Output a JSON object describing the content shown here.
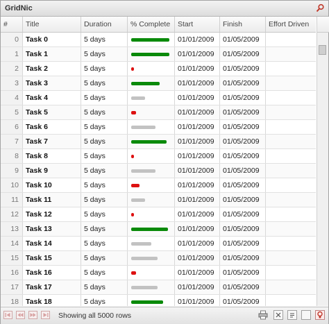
{
  "grid": {
    "title": "GridNic"
  },
  "columns": [
    {
      "key": "idx",
      "label": "#"
    },
    {
      "key": "title",
      "label": "Title"
    },
    {
      "key": "duration",
      "label": "Duration"
    },
    {
      "key": "pct",
      "label": "% Complete"
    },
    {
      "key": "start",
      "label": "Start"
    },
    {
      "key": "finish",
      "label": "Finish"
    },
    {
      "key": "effort",
      "label": "Effort Driven"
    }
  ],
  "rows": [
    {
      "idx": "0",
      "title": "Task 0",
      "duration": "5 days",
      "pct": 95,
      "start": "01/01/2009",
      "finish": "01/05/2009",
      "effort": ""
    },
    {
      "idx": "1",
      "title": "Task 1",
      "duration": "5 days",
      "pct": 95,
      "start": "01/01/2009",
      "finish": "01/05/2009",
      "effort": ""
    },
    {
      "idx": "2",
      "title": "Task 2",
      "duration": "5 days",
      "pct": 5,
      "start": "01/01/2009",
      "finish": "01/05/2009",
      "effort": ""
    },
    {
      "idx": "3",
      "title": "Task 3",
      "duration": "5 days",
      "pct": 70,
      "start": "01/01/2009",
      "finish": "01/05/2009",
      "effort": ""
    },
    {
      "idx": "4",
      "title": "Task 4",
      "duration": "5 days",
      "pct": 35,
      "start": "01/01/2009",
      "finish": "01/05/2009",
      "effort": ""
    },
    {
      "idx": "5",
      "title": "Task 5",
      "duration": "5 days",
      "pct": 12,
      "start": "01/01/2009",
      "finish": "01/05/2009",
      "effort": ""
    },
    {
      "idx": "6",
      "title": "Task 6",
      "duration": "5 days",
      "pct": 60,
      "start": "01/01/2009",
      "finish": "01/05/2009",
      "effort": ""
    },
    {
      "idx": "7",
      "title": "Task 7",
      "duration": "5 days",
      "pct": 88,
      "start": "01/01/2009",
      "finish": "01/05/2009",
      "effort": ""
    },
    {
      "idx": "8",
      "title": "Task 8",
      "duration": "5 days",
      "pct": 5,
      "start": "01/01/2009",
      "finish": "01/05/2009",
      "effort": ""
    },
    {
      "idx": "9",
      "title": "Task 9",
      "duration": "5 days",
      "pct": 60,
      "start": "01/01/2009",
      "finish": "01/05/2009",
      "effort": ""
    },
    {
      "idx": "10",
      "title": "Task 10",
      "duration": "5 days",
      "pct": 20,
      "start": "01/01/2009",
      "finish": "01/05/2009",
      "effort": ""
    },
    {
      "idx": "11",
      "title": "Task 11",
      "duration": "5 days",
      "pct": 35,
      "start": "01/01/2009",
      "finish": "01/05/2009",
      "effort": ""
    },
    {
      "idx": "12",
      "title": "Task 12",
      "duration": "5 days",
      "pct": 5,
      "start": "01/01/2009",
      "finish": "01/05/2009",
      "effort": ""
    },
    {
      "idx": "13",
      "title": "Task 13",
      "duration": "5 days",
      "pct": 92,
      "start": "01/01/2009",
      "finish": "01/05/2009",
      "effort": ""
    },
    {
      "idx": "14",
      "title": "Task 14",
      "duration": "5 days",
      "pct": 50,
      "start": "01/01/2009",
      "finish": "01/05/2009",
      "effort": ""
    },
    {
      "idx": "15",
      "title": "Task 15",
      "duration": "5 days",
      "pct": 65,
      "start": "01/01/2009",
      "finish": "01/05/2009",
      "effort": ""
    },
    {
      "idx": "16",
      "title": "Task 16",
      "duration": "5 days",
      "pct": 12,
      "start": "01/01/2009",
      "finish": "01/05/2009",
      "effort": ""
    },
    {
      "idx": "17",
      "title": "Task 17",
      "duration": "5 days",
      "pct": 65,
      "start": "01/01/2009",
      "finish": "01/05/2009",
      "effort": ""
    },
    {
      "idx": "18",
      "title": "Task 18",
      "duration": "5 days",
      "pct": 80,
      "start": "01/01/2009",
      "finish": "01/05/2009",
      "effort": ""
    }
  ],
  "colors": {
    "high": "#0a8a0a",
    "mid": "#c2c2c2",
    "low": "#dd1111"
  },
  "icons": {
    "search": "search-icon",
    "pager": [
      "first-page-icon",
      "prev-page-icon",
      "next-page-icon",
      "last-page-icon"
    ],
    "toolbar": [
      "print-icon",
      "close-grid-icon",
      "edit-icon",
      "blank-page-icon",
      "bulb-icon"
    ]
  },
  "footer": {
    "status": "Showing all 5000 rows"
  }
}
